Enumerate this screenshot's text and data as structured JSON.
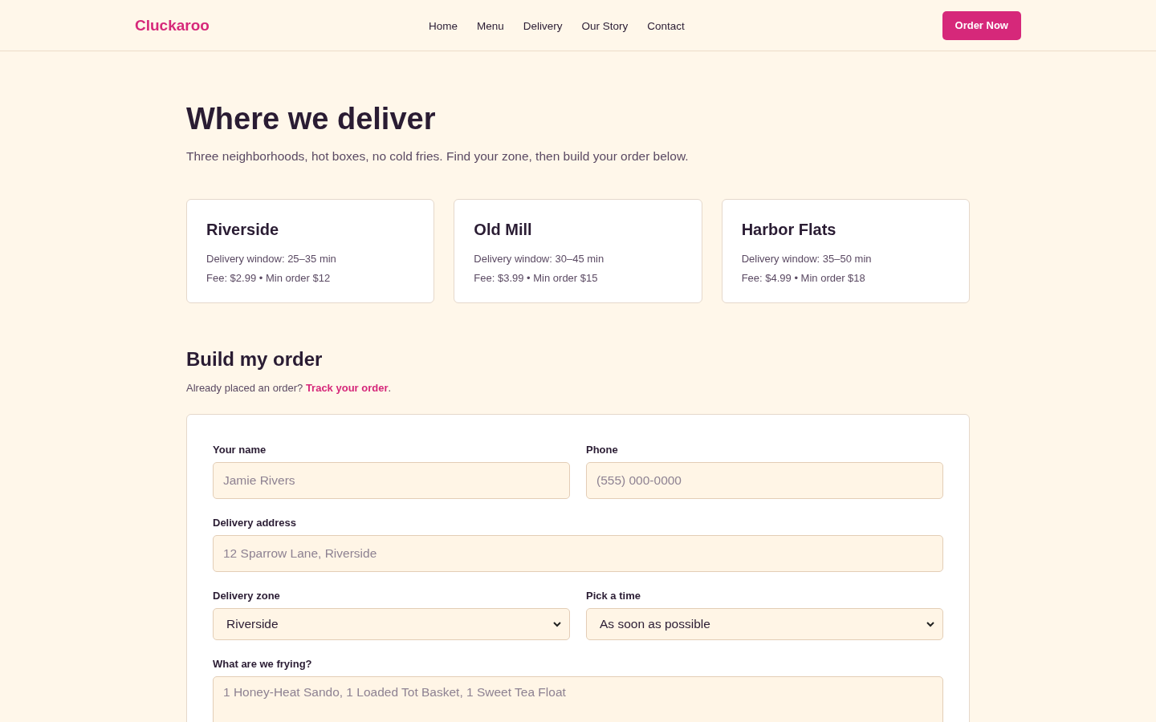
{
  "nav": {
    "brand": "Cluckaroo",
    "links": [
      "Home",
      "Menu",
      "Delivery",
      "Our Story",
      "Contact"
    ],
    "cta": "Order Now"
  },
  "hero": {
    "title": "Where we deliver",
    "subtitle": "Three neighborhoods, hot boxes, no cold fries. Find your zone, then build your order below."
  },
  "zones": [
    {
      "name": "Riverside",
      "window": "Delivery window: 25–35 min",
      "fee": "Fee: $2.99 • Min order $12"
    },
    {
      "name": "Old Mill",
      "window": "Delivery window: 30–45 min",
      "fee": "Fee: $3.99 • Min order $15"
    },
    {
      "name": "Harbor Flats",
      "window": "Delivery window: 35–50 min",
      "fee": "Fee: $4.99 • Min order $18"
    }
  ],
  "order": {
    "title": "Build my order",
    "prompt": "Already placed an order?",
    "link": "Track your order",
    "after": ".",
    "rows": [
      [
        {
          "kind": "input",
          "label": "Your name",
          "placeholder": "Jamie Rivers"
        },
        {
          "kind": "input",
          "label": "Phone",
          "placeholder": "(555) 000-0000"
        }
      ],
      [
        {
          "kind": "input",
          "label": "Delivery address",
          "placeholder": "12 Sparrow Lane, Riverside"
        }
      ],
      [
        {
          "kind": "select",
          "label": "Delivery zone",
          "value": "Riverside"
        },
        {
          "kind": "select",
          "label": "Pick a time",
          "value": "As soon as possible"
        }
      ],
      [
        {
          "kind": "textarea",
          "label": "What are we frying?",
          "placeholder": "1 Honey-Heat Sando, 1 Loaded Tot Basket, 1 Sweet Tea Float"
        }
      ]
    ]
  }
}
